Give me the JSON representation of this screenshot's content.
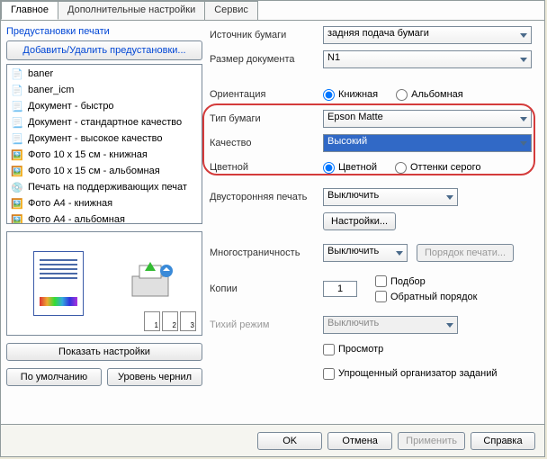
{
  "tabs": {
    "t0": "Главное",
    "t1": "Дополнительные настройки",
    "t2": "Сервис"
  },
  "left": {
    "title": "Предустановки печати",
    "add_btn": "Добавить/Удалить предустановки...",
    "items": {
      "i0": "baner",
      "i1": "baner_icm",
      "i2": "Документ - быстро",
      "i3": "Документ - стандартное качество",
      "i4": "Документ - высокое качество",
      "i5": "Фото 10 x 15 см - книжная",
      "i6": "Фото 10 x 15 см - альбомная",
      "i7": "Печать на поддерживающих печат",
      "i8": "Фото А4 - книжная",
      "i9": "Фото А4 - альбомная"
    },
    "show_settings": "Показать настройки",
    "defaults": "По умолчанию",
    "ink_levels": "Уровень чернил"
  },
  "right": {
    "source_label": "Источник бумаги",
    "source_val": "задняя подача бумаги",
    "size_label": "Размер документа",
    "size_val": "N1",
    "orient_label": "Ориентация",
    "orient_portrait": "Книжная",
    "orient_landscape": "Альбомная",
    "paper_label": "Тип бумаги",
    "paper_val": "Epson Matte",
    "quality_label": "Качество",
    "quality_val": "Высокий",
    "color_label": "Цветной",
    "color_color": "Цветной",
    "color_gray": "Оттенки серого",
    "duplex_label": "Двусторонняя печать",
    "duplex_val": "Выключить",
    "settings_btn": "Настройки...",
    "multi_label": "Многостраничность",
    "multi_val": "Выключить",
    "print_order_btn": "Порядок печати...",
    "copies_label": "Копии",
    "copies_val": "1",
    "collate": "Подбор",
    "reverse": "Обратный порядок",
    "quiet_label": "Тихий режим",
    "quiet_val": "Выключить",
    "preview_chk": "Просмотр",
    "simple_org": "Упрощенный организатор заданий"
  },
  "bottom": {
    "ok": "OK",
    "cancel": "Отмена",
    "apply": "Применить",
    "help": "Справка"
  },
  "page_nums": {
    "p1": "1",
    "p2": "2",
    "p3": "3"
  }
}
